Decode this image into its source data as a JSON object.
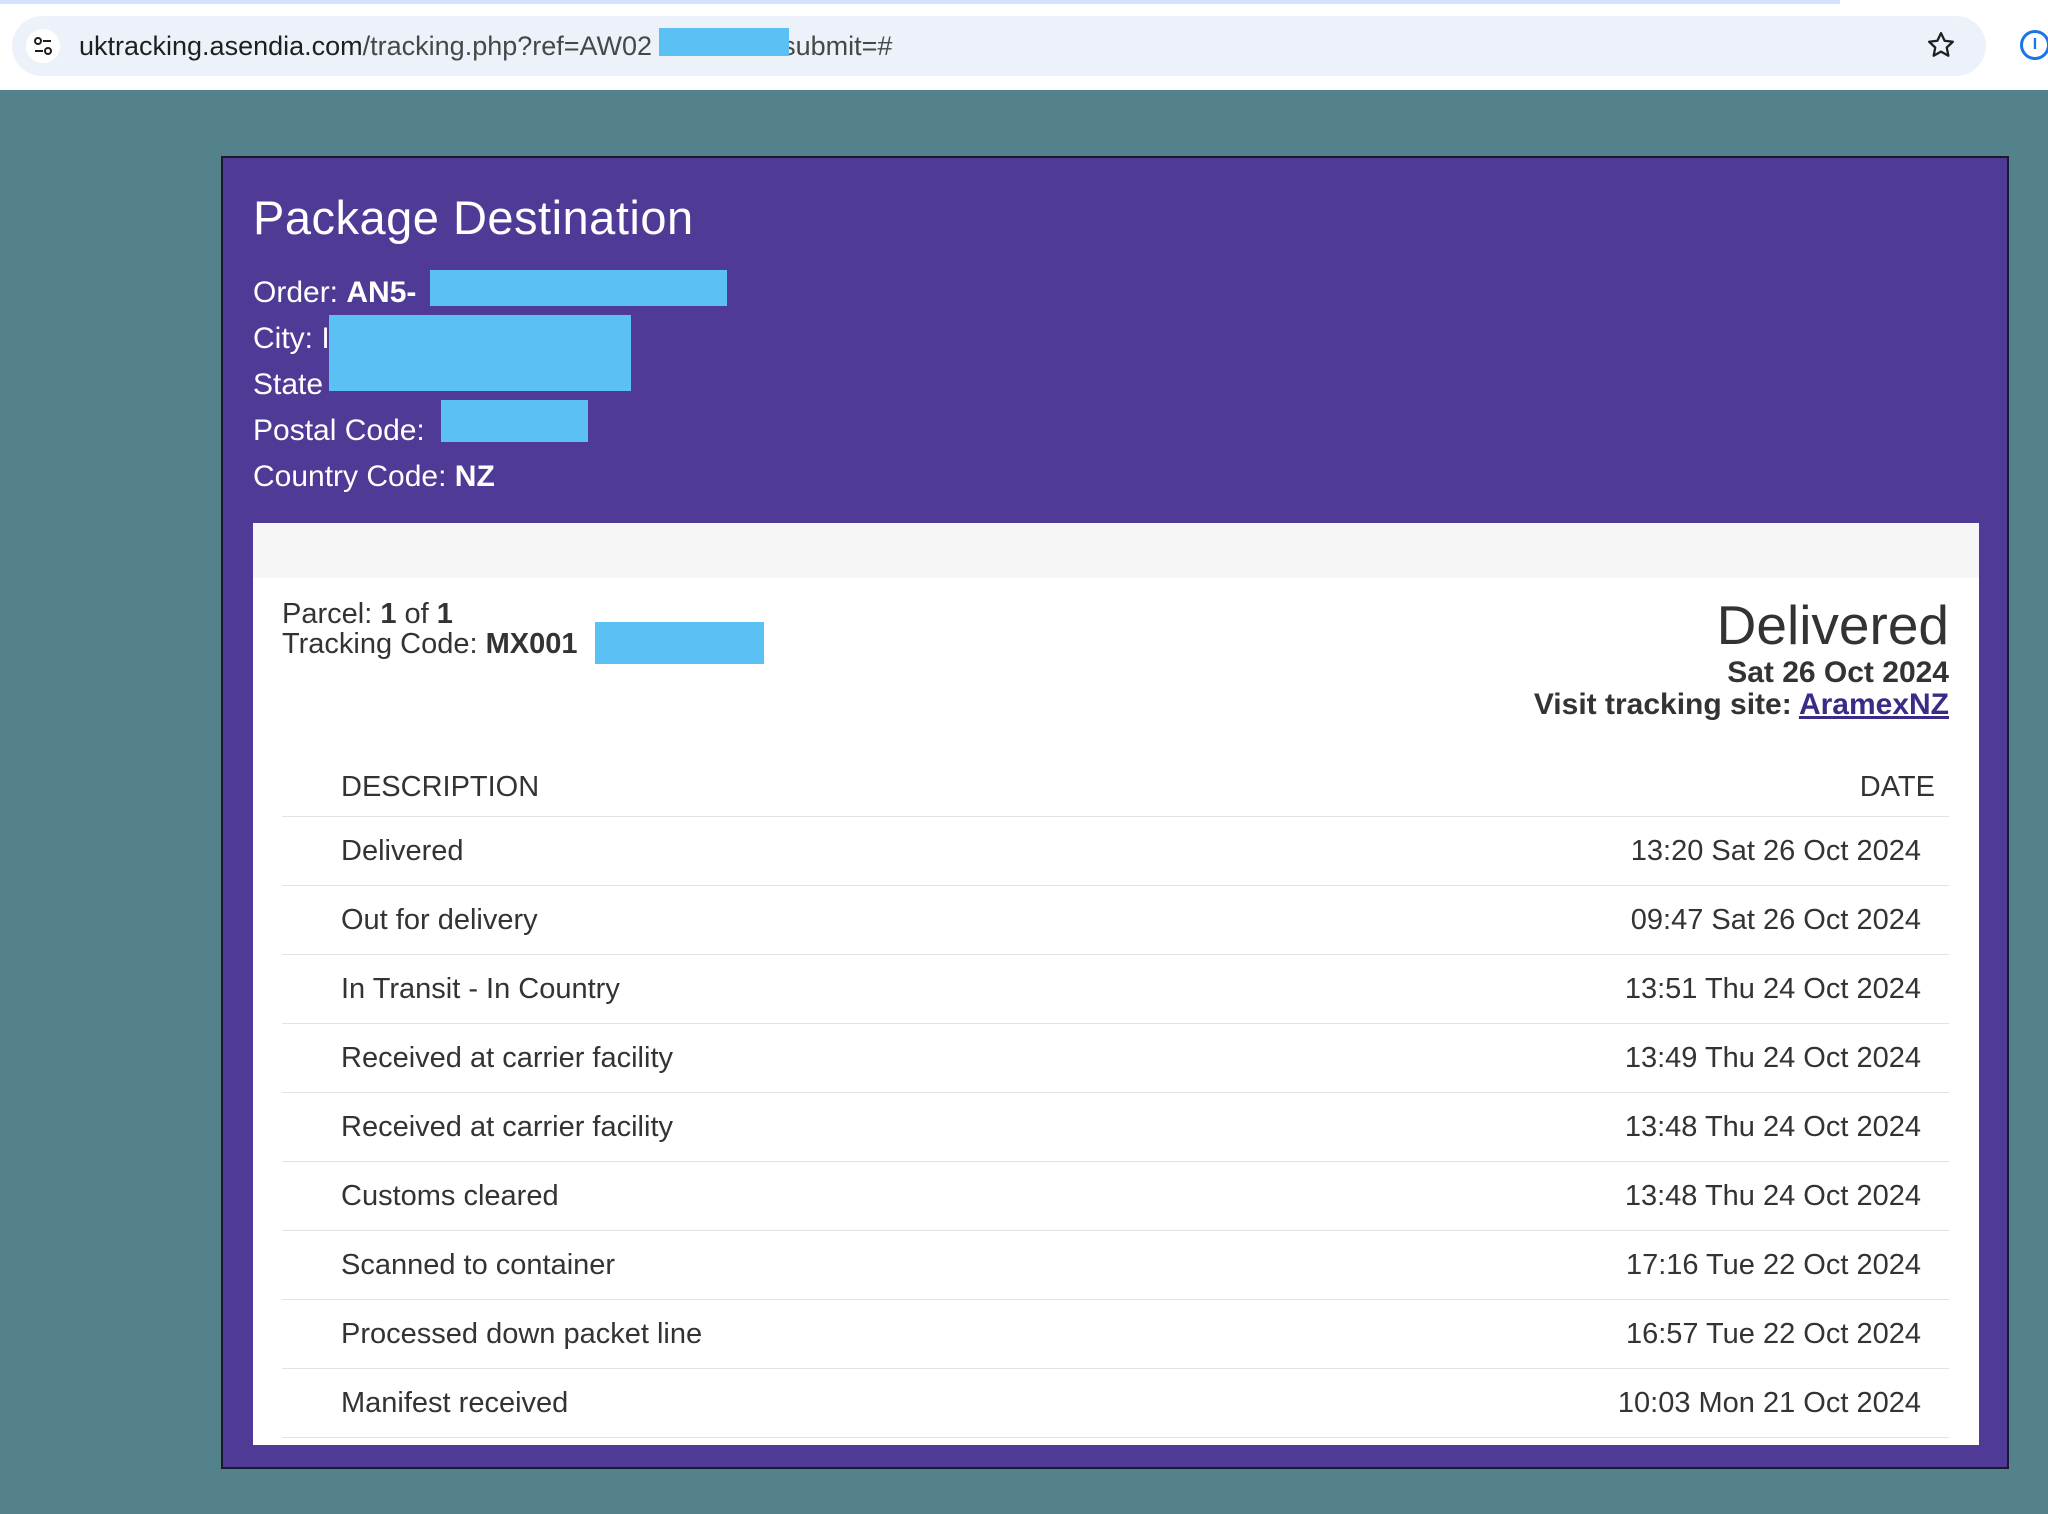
{
  "browser": {
    "url_host": "uktracking.asendia.com",
    "url_path": "/tracking.php?ref=AW02",
    "url_tail": "submit=#",
    "icons": [
      "site-info-icon",
      "bookmark-star-icon",
      "password-manager-icon"
    ]
  },
  "destination": {
    "title": "Package Destination",
    "order_label": "Order:",
    "order_value": "AN5-",
    "city_label": "City:",
    "city_value": "I",
    "state_label": "State",
    "postal_label": "Postal Code:",
    "country_label": "Country Code:",
    "country_value": "NZ"
  },
  "parcel": {
    "parcel_label": "Parcel:",
    "parcel_index": "1",
    "parcel_of": "of",
    "parcel_total": "1",
    "tracking_label": "Tracking Code:",
    "tracking_value": "MX001",
    "status": "Delivered",
    "status_date": "Sat 26 Oct 2024",
    "visit_label": "Visit tracking site:",
    "visit_link": "AramexNZ"
  },
  "events": {
    "headers": {
      "description": "DESCRIPTION",
      "date": "DATE"
    },
    "rows": [
      {
        "description": "Delivered",
        "date": "13:20 Sat 26 Oct 2024"
      },
      {
        "description": "Out for delivery",
        "date": "09:47 Sat 26 Oct 2024"
      },
      {
        "description": "In Transit - In Country",
        "date": "13:51 Thu 24 Oct 2024"
      },
      {
        "description": "Received at carrier facility",
        "date": "13:49 Thu 24 Oct 2024"
      },
      {
        "description": "Received at carrier facility",
        "date": "13:48 Thu 24 Oct 2024"
      },
      {
        "description": "Customs cleared",
        "date": "13:48 Thu 24 Oct 2024"
      },
      {
        "description": "Scanned to container",
        "date": "17:16 Tue 22 Oct 2024"
      },
      {
        "description": "Processed down packet line",
        "date": "16:57 Tue 22 Oct 2024"
      },
      {
        "description": "Manifest received",
        "date": "10:03 Mon 21 Oct 2024"
      }
    ]
  },
  "colors": {
    "page_bg": "#53828d",
    "card_bg": "#4f3a96",
    "redaction": "#5bc0f3",
    "link": "#3b2a86"
  }
}
